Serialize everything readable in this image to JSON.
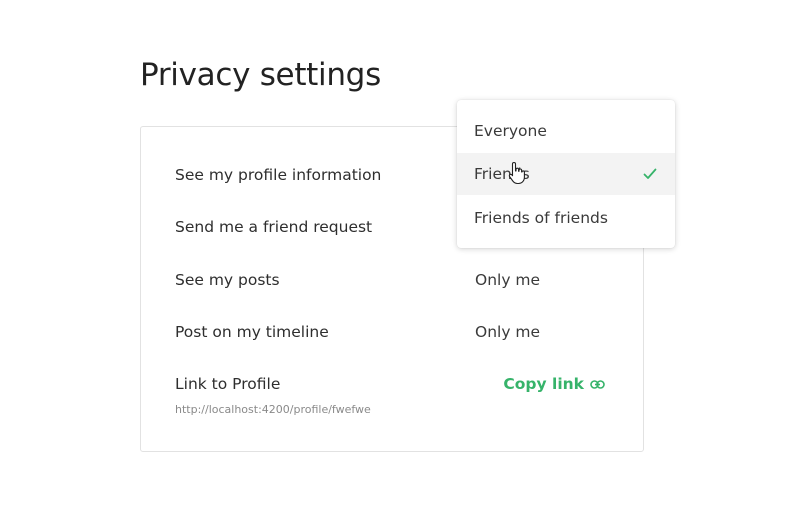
{
  "page": {
    "title": "Privacy settings"
  },
  "settings": {
    "rows": [
      {
        "label": "See my profile information",
        "value": ""
      },
      {
        "label": "Send me a friend request",
        "value": ""
      },
      {
        "label": "See my posts",
        "value": "Only me"
      },
      {
        "label": "Post on my timeline",
        "value": "Only me"
      }
    ],
    "profile_link": {
      "label": "Link to Profile",
      "url": "http://localhost:4200/profile/fwefwe",
      "copy_label": "Copy link"
    }
  },
  "dropdown": {
    "options": [
      "Everyone",
      "Friends",
      "Friends of friends"
    ],
    "selected": "Friends"
  },
  "icons": {
    "check": "check-icon",
    "link": "link-icon",
    "cursor": "hand-cursor-icon"
  },
  "colors": {
    "accent": "#36b36a",
    "hover_bg": "#f3f3f3",
    "border": "#e2e2e2"
  }
}
